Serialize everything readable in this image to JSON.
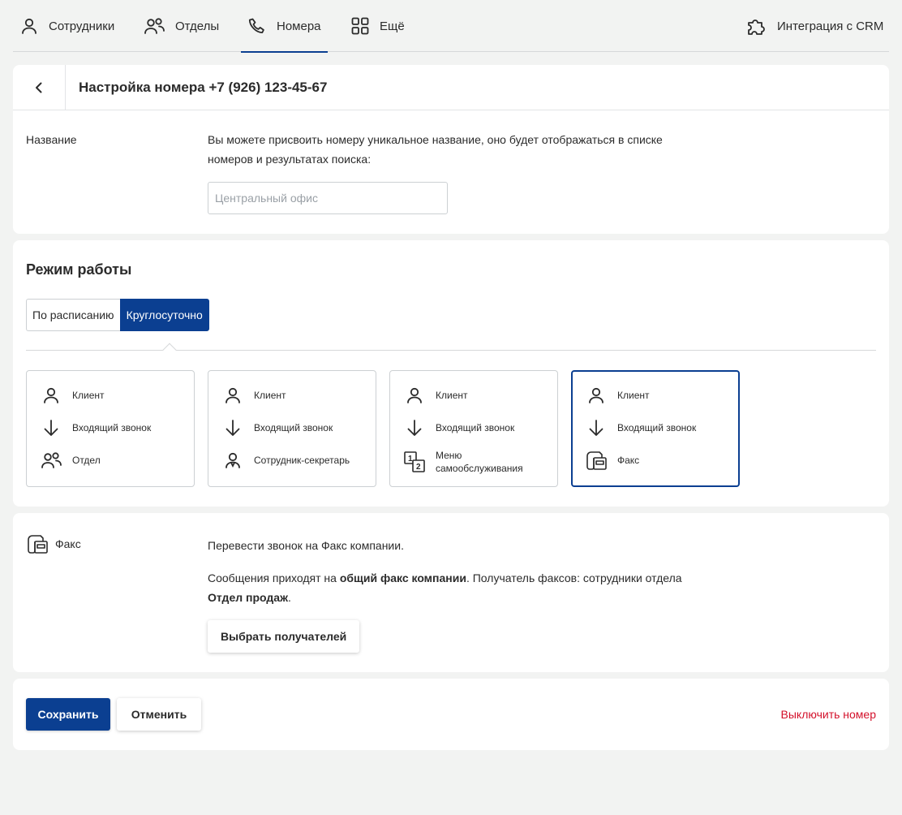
{
  "nav": {
    "employees": "Сотрудники",
    "departments": "Отделы",
    "numbers": "Номера",
    "more": "Ещё",
    "crm": "Интеграция с CRM"
  },
  "header": {
    "title": "Настройка номера +7 (926) 123-45-67"
  },
  "name_field": {
    "label": "Название",
    "description": "Вы можете присвоить номеру уникальное название, оно будет отображаться в списке номеров и результатах поиска:",
    "placeholder": "Центральный офис",
    "value": ""
  },
  "mode": {
    "title": "Режим работы",
    "options": [
      "По расписанию",
      "Круглосуточно"
    ],
    "selected": "Круглосуточно",
    "scenarios": [
      {
        "client": "Клиент",
        "call": "Входящий звонок",
        "target": "Отдел",
        "target_icon": "group-icon",
        "selected": false
      },
      {
        "client": "Клиент",
        "call": "Входящий звонок",
        "target": "Сотрудник-секретарь",
        "target_icon": "secretary-icon",
        "selected": false
      },
      {
        "client": "Клиент",
        "call": "Входящий звонок",
        "target": "Меню самообслуживания",
        "target_icon": "ivr-menu-icon",
        "selected": false
      },
      {
        "client": "Клиент",
        "call": "Входящий звонок",
        "target": "Факс",
        "target_icon": "fax-icon",
        "selected": true
      }
    ]
  },
  "fax": {
    "label": "Факс",
    "line1": "Перевести звонок на Факс компании.",
    "line2_prefix": "Сообщения приходят на ",
    "line2_bold": "общий факс компании",
    "line2_mid": ". Получатель факсов: сотрудники отдела ",
    "line2_dept": "Отдел продаж",
    "line2_end": ".",
    "choose_button": "Выбрать получателей"
  },
  "footer": {
    "save": "Сохранить",
    "cancel": "Отменить",
    "disable": "Выключить номер"
  },
  "colors": {
    "accent": "#0b3f91",
    "danger": "#d3102a",
    "background": "#f2f3f2"
  }
}
